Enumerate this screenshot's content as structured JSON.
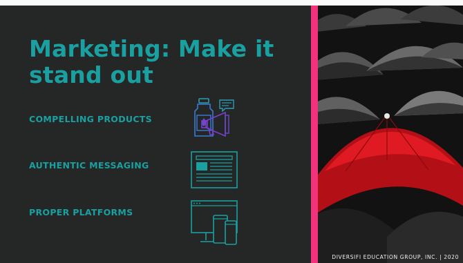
{
  "slide": {
    "title": "Marketing: Make it stand out",
    "items": [
      {
        "label": "COMPELLING PRODUCTS",
        "icon": "product-bottle-megaphone-icon"
      },
      {
        "label": "AUTHENTIC MESSAGING",
        "icon": "article-document-icon"
      },
      {
        "label": "PROPER PLATFORMS",
        "icon": "devices-icon"
      }
    ],
    "copyright": "DIVERSIFI EDUCATION GROUP, INC. | 2020"
  },
  "colors": {
    "background": "#252626",
    "accent_teal": "#1aa0a0",
    "accent_pink": "#f0337a",
    "umbrella_red": "#d8141c"
  }
}
